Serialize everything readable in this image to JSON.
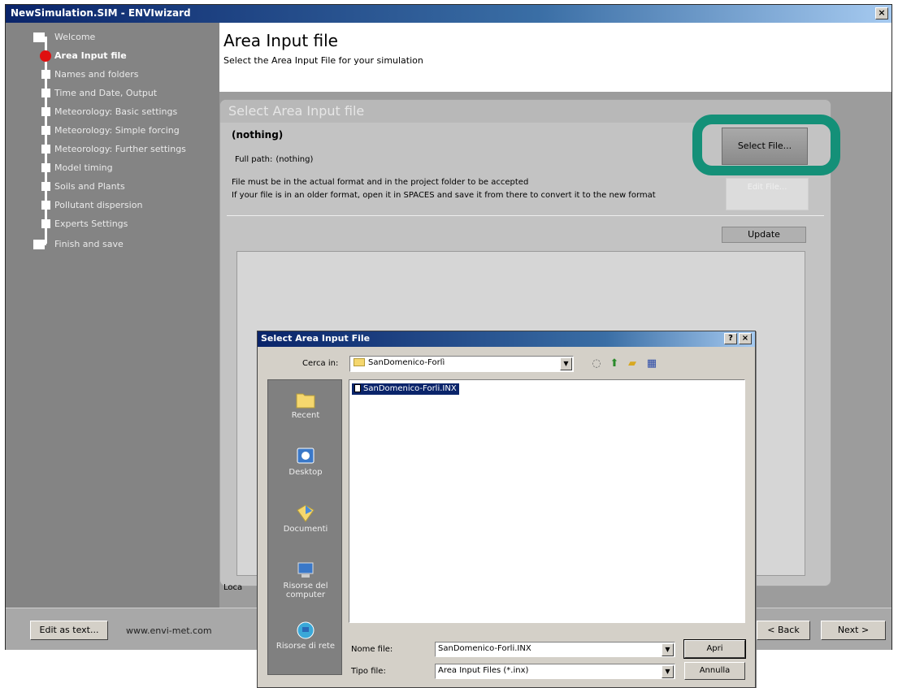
{
  "window": {
    "title": "NewSimulation.SIM - ENVIwizard",
    "close_glyph": "×"
  },
  "sidebar": {
    "items": [
      {
        "label": "Welcome"
      },
      {
        "label": "Area Input file"
      },
      {
        "label": "Names and folders"
      },
      {
        "label": "Time and Date, Output"
      },
      {
        "label": "Meteorology: Basic settings"
      },
      {
        "label": "Meteorology: Simple forcing"
      },
      {
        "label": "Meteorology: Further settings"
      },
      {
        "label": "Model timing"
      },
      {
        "label": "Soils and Plants"
      },
      {
        "label": "Pollutant dispersion"
      },
      {
        "label": "Experts Settings"
      },
      {
        "label": "Finish and save"
      }
    ],
    "active_index": 1,
    "active_color": "#e01010"
  },
  "header": {
    "title": "Area Input file",
    "subtitle": "Select the Area Input File for your simulation"
  },
  "panel": {
    "title": "Select Area Input file",
    "selected": "(nothing)",
    "fullpath_label": "Full path:",
    "fullpath_value": "(nothing)",
    "note1": "File must be in the actual format and in the project folder to be accepted",
    "note2": "If your file is in an older format, open it in SPACES and save it from there to convert it to the new format",
    "select_button": "Select File...",
    "edit_button": "Edit File...",
    "update_button": "Update",
    "bottom_label": "Loca",
    "highlight_color": "#149078"
  },
  "footer": {
    "edit_as_text": "Edit as text...",
    "website": "www.envi-met.com",
    "back": "< Back",
    "next": "Next >"
  },
  "dialog": {
    "title": "Select Area Input File",
    "help_glyph": "?",
    "close_glyph": "×",
    "look_in_label": "Cerca in:",
    "look_in_value": "SanDomenico-Forlì",
    "places": [
      {
        "label": "Recent"
      },
      {
        "label": "Desktop"
      },
      {
        "label": "Documenti"
      },
      {
        "label": "Risorse del computer"
      },
      {
        "label": "Risorse di rete"
      }
    ],
    "files": [
      "SanDomenico-Forli.INX"
    ],
    "filename_label": "Nome file:",
    "filename_value": "SanDomenico-Forli.INX",
    "filetype_label": "Tipo file:",
    "filetype_value": "Area Input Files (*.inx)",
    "open_button": "Apri",
    "cancel_button": "Annulla"
  }
}
